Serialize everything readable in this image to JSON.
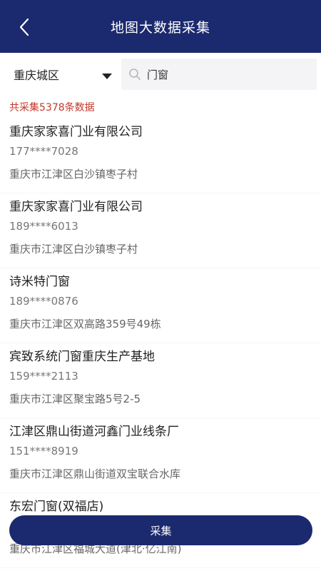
{
  "header": {
    "title": "地图大数据采集"
  },
  "filter": {
    "city": "重庆城区",
    "search_value": "门窗"
  },
  "count_text": "共采集5378条数据",
  "results": [
    {
      "name": "重庆家家喜门业有限公司",
      "phone": "177****7028",
      "address": "重庆市江津区白沙镇枣子村"
    },
    {
      "name": "重庆家家喜门业有限公司",
      "phone": "189****6013",
      "address": "重庆市江津区白沙镇枣子村"
    },
    {
      "name": "诗米特门窗",
      "phone": "189****0876",
      "address": "重庆市江津区双高路359号49栋"
    },
    {
      "name": "宾致系统门窗重庆生产基地",
      "phone": "159****2113",
      "address": "重庆市江津区聚宝路5号2-5"
    },
    {
      "name": "江津区鼎山街道河鑫门业线条厂",
      "phone": "151****8919",
      "address": "重庆市江津区鼎山街道双宝联合水库"
    },
    {
      "name": "东宏门窗(双福店)",
      "phone": "",
      "address": "重庆市江津区福城大道(津北·亿江南)"
    }
  ],
  "collect_button": "采集",
  "colors": {
    "primary": "#1b2a6e",
    "count_text": "#c0392b"
  },
  "icons": {
    "back": "chevron-left-icon",
    "dropdown": "caret-down-icon",
    "search": "search-icon"
  }
}
